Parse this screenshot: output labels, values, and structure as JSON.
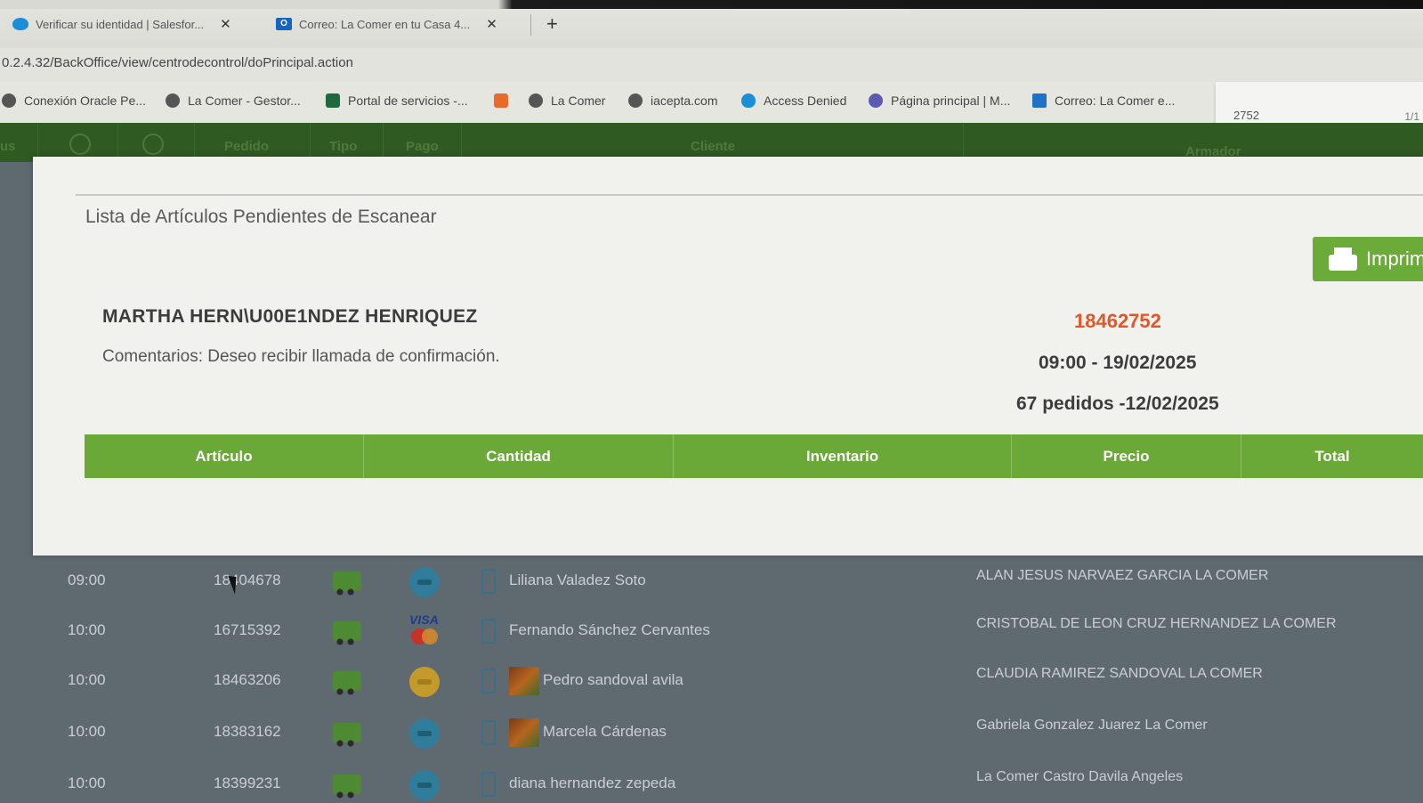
{
  "browser": {
    "tabs": [
      {
        "title": "Verificar su identidad | Salesfor...",
        "icon": "salesforce-icon"
      },
      {
        "title": "Correo: La Comer en tu Casa 4...",
        "icon": "outlook-icon"
      }
    ],
    "new_tab_symbol": "+",
    "close_symbol": "✕",
    "url": "0.2.4.32/BackOffice/view/centrodecontrol/doPrincipal.action",
    "bookmarks": [
      "Conexión Oracle Pe...",
      "La Comer - Gestor...",
      "Portal de servicios -...",
      "",
      "La Comer",
      "iacepta.com",
      "Access Denied",
      "Página principal | M...",
      "Correo: La Comer e..."
    ],
    "find": {
      "text": "2752",
      "count": "1/1"
    }
  },
  "app_header": {
    "cols": [
      "us",
      "Pedido",
      "Tipo",
      "Pago",
      "Cliente",
      "Armador"
    ]
  },
  "modal": {
    "title": "Lista de Artículos Pendientes de Escanear",
    "print_label": "Imprim",
    "customer_name": "MARTHA HERN\\U00E1NDEZ HENRIQUEZ",
    "comments": "Comentarios: Deseo recibir llamada de confirmación.",
    "order_number": "18462752",
    "delivery": "09:00 - 19/02/2025",
    "orders_count": "67 pedidos -12/02/2025",
    "columns": [
      "Artículo",
      "Cantidad",
      "Inventario",
      "Precio",
      "Total"
    ]
  },
  "orders": [
    {
      "time": "09:00",
      "id": "18404678",
      "payment": "card",
      "photo": false,
      "client": "Liliana Valadez Soto",
      "armador": "ALAN JESUS NARVAEZ GARCIA LA COMER"
    },
    {
      "time": "10:00",
      "id": "16715392",
      "payment": "visa",
      "photo": false,
      "client": "Fernando Sánchez Cervantes",
      "armador": "CRISTOBAL DE LEON CRUZ HERNANDEZ LA COMER"
    },
    {
      "time": "10:00",
      "id": "18463206",
      "payment": "cash",
      "photo": true,
      "client": "Pedro sandoval avila",
      "armador": "CLAUDIA RAMIREZ SANDOVAL LA COMER"
    },
    {
      "time": "10:00",
      "id": "18383162",
      "payment": "card",
      "photo": true,
      "client": "Marcela Cárdenas",
      "armador": "Gabriela Gonzalez Juarez La Comer"
    },
    {
      "time": "10:00",
      "id": "18399231",
      "payment": "card",
      "photo": false,
      "client": "diana hernandez zepeda",
      "armador": "La Comer Castro Davila Angeles"
    }
  ],
  "visa_text": "VISA",
  "colors": {
    "brand_green": "#6aa838",
    "header_green": "#2f5a22",
    "order_number": "#e0572a"
  }
}
